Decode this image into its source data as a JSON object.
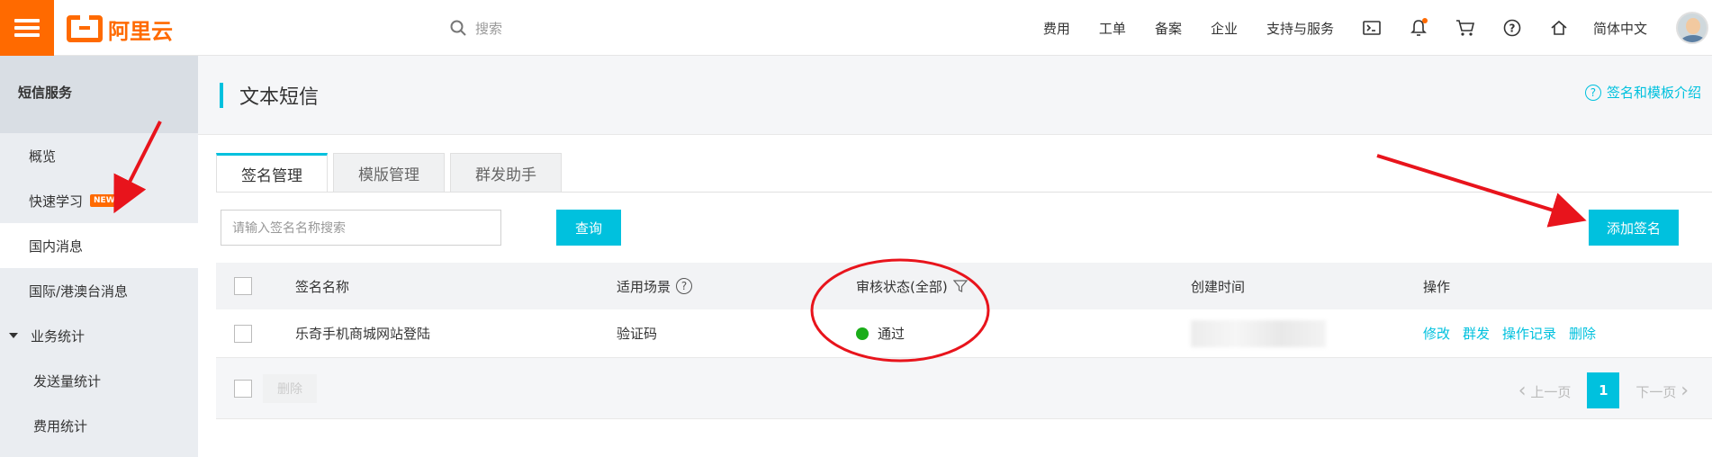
{
  "topbar": {
    "logo_text": "阿里云",
    "search_placeholder": "搜索",
    "nav": [
      "费用",
      "工单",
      "备案",
      "企业",
      "支持与服务"
    ],
    "language": "简体中文"
  },
  "sidebar": {
    "header": "短信服务",
    "items": [
      {
        "label": "概览"
      },
      {
        "label": "快速学习",
        "badge": "NEW"
      },
      {
        "label": "国内消息"
      },
      {
        "label": "国际/港澳台消息"
      },
      {
        "label": "业务统计"
      },
      {
        "label": "发送量统计"
      },
      {
        "label": "费用统计"
      }
    ]
  },
  "main": {
    "title": "文本短信",
    "help_link": "签名和模板介绍",
    "tabs": [
      "签名管理",
      "模版管理",
      "群发助手"
    ],
    "search_placeholder": "请输入签名名称搜索",
    "query_button": "查询",
    "add_button": "添加签名",
    "table": {
      "headers": [
        "签名名称",
        "适用场景",
        "审核状态(全部)",
        "创建时间",
        "操作"
      ],
      "rows": [
        {
          "name": "乐奇手机商城网站登陆",
          "scene": "验证码",
          "status": "通过",
          "actions": [
            "修改",
            "群发",
            "操作记录",
            "删除"
          ]
        }
      ]
    },
    "delete_button": "删除",
    "pager": {
      "prev": "上一页",
      "page": "1",
      "next": "下一页"
    }
  },
  "colors": {
    "accent": "#00c1de",
    "brand": "#ff6a00",
    "annotation": "#e8141c",
    "status_ok": "#1aad19"
  }
}
